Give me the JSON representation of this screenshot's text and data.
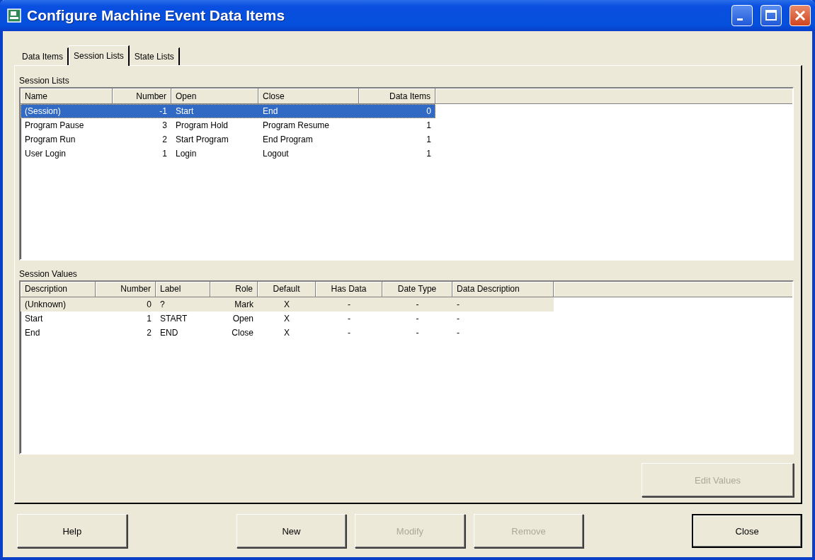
{
  "window": {
    "title": "Configure Machine Event Data Items"
  },
  "tabs": [
    {
      "label": "Data Items",
      "selected": false
    },
    {
      "label": "Session Lists",
      "selected": true
    },
    {
      "label": "State Lists",
      "selected": false
    }
  ],
  "session_lists": {
    "label": "Session Lists",
    "columns": [
      "Name",
      "Number",
      "Open",
      "Close",
      "Data Items"
    ],
    "rows": [
      {
        "cells": [
          "(Session)",
          "-1",
          "Start",
          "End",
          "0"
        ],
        "selected": true
      },
      {
        "cells": [
          "Program Pause",
          "3",
          "Program Hold",
          "Program Resume",
          "1"
        ],
        "selected": false
      },
      {
        "cells": [
          "Program Run",
          "2",
          "Start Program",
          "End Program",
          "1"
        ],
        "selected": false
      },
      {
        "cells": [
          "User Login",
          "1",
          "Login",
          "Logout",
          "1"
        ],
        "selected": false
      }
    ]
  },
  "session_values": {
    "label": "Session Values",
    "columns": [
      "Description",
      "Number",
      "Label",
      "Role",
      "Default",
      "Has Data",
      "Date Type",
      "Data Description"
    ],
    "rows": [
      {
        "cells": [
          "(Unknown)",
          "0",
          "?",
          "Mark",
          "X",
          "-",
          "-",
          "-"
        ],
        "selected": true
      },
      {
        "cells": [
          "Start",
          "1",
          "START",
          "Open",
          "X",
          "-",
          "-",
          "-"
        ],
        "selected": false
      },
      {
        "cells": [
          "End",
          "2",
          "END",
          "Close",
          "X",
          "-",
          "-",
          "-"
        ],
        "selected": false
      }
    ]
  },
  "edit_values_button": {
    "label": "Edit Values",
    "disabled": true
  },
  "buttons": [
    {
      "label": "Help",
      "disabled": false,
      "default": false
    },
    {
      "label": "New",
      "disabled": false,
      "default": false
    },
    {
      "label": "Modify",
      "disabled": true,
      "default": false
    },
    {
      "label": "Remove",
      "disabled": true,
      "default": false
    },
    {
      "label": "Close",
      "disabled": false,
      "default": true
    }
  ]
}
